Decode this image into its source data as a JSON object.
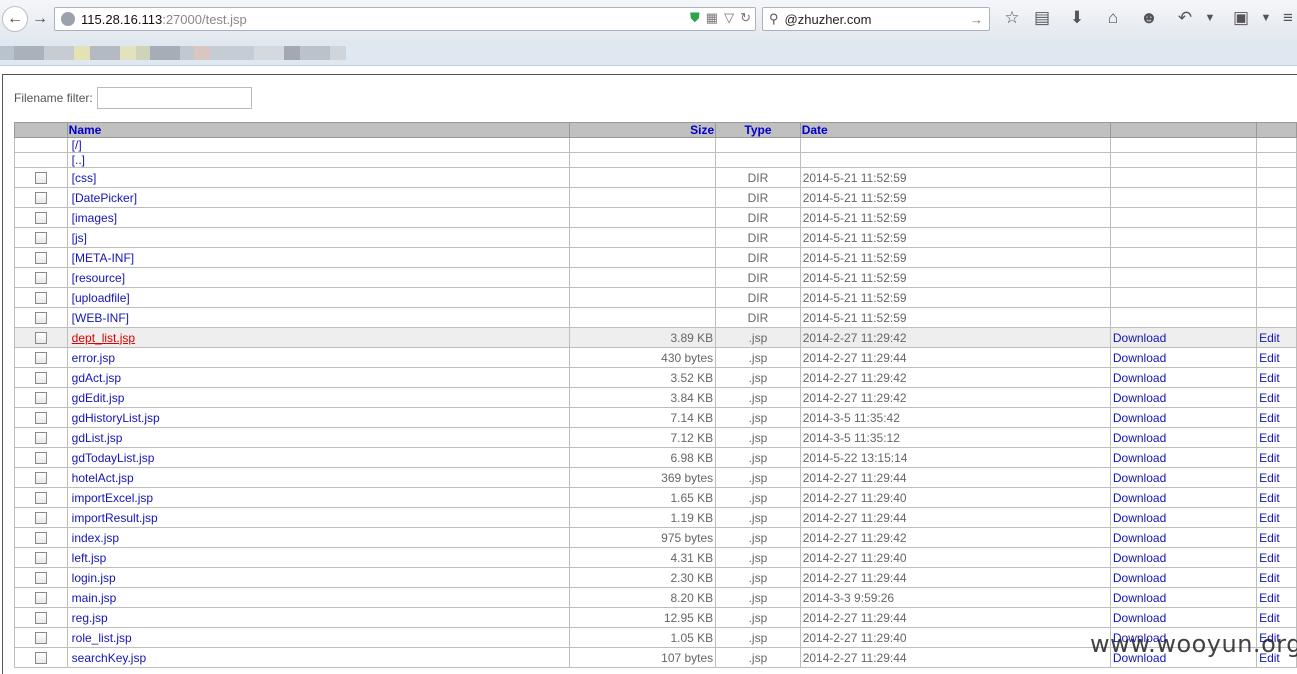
{
  "browser": {
    "url_host": "115.28.16.113",
    "url_rest": ":27000/test.jsp",
    "search_text": "@zhuzher.com"
  },
  "filter": {
    "label": "Filename filter:",
    "value": ""
  },
  "table": {
    "headers": {
      "name": "Name",
      "size": "Size",
      "type": "Type",
      "date": "Date"
    },
    "nav": [
      "[/]",
      "[..]"
    ],
    "rows": [
      {
        "name": "[css]",
        "size": "",
        "type": "DIR",
        "date": "2014-5-21 11:52:59",
        "download": "",
        "edit": ""
      },
      {
        "name": "[DatePicker]",
        "size": "",
        "type": "DIR",
        "date": "2014-5-21 11:52:59",
        "download": "",
        "edit": ""
      },
      {
        "name": "[images]",
        "size": "",
        "type": "DIR",
        "date": "2014-5-21 11:52:59",
        "download": "",
        "edit": ""
      },
      {
        "name": "[js]",
        "size": "",
        "type": "DIR",
        "date": "2014-5-21 11:52:59",
        "download": "",
        "edit": ""
      },
      {
        "name": "[META-INF]",
        "size": "",
        "type": "DIR",
        "date": "2014-5-21 11:52:59",
        "download": "",
        "edit": ""
      },
      {
        "name": "[resource]",
        "size": "",
        "type": "DIR",
        "date": "2014-5-21 11:52:59",
        "download": "",
        "edit": ""
      },
      {
        "name": "[uploadfile]",
        "size": "",
        "type": "DIR",
        "date": "2014-5-21 11:52:59",
        "download": "",
        "edit": ""
      },
      {
        "name": "[WEB-INF]",
        "size": "",
        "type": "DIR",
        "date": "2014-5-21 11:52:59",
        "download": "",
        "edit": ""
      },
      {
        "name": "dept_list.jsp",
        "size": "3.89 KB",
        "type": ".jsp",
        "date": "2014-2-27 11:29:42",
        "download": "Download",
        "edit": "Edit",
        "hover": true
      },
      {
        "name": "error.jsp",
        "size": "430 bytes",
        "type": ".jsp",
        "date": "2014-2-27 11:29:44",
        "download": "Download",
        "edit": "Edit"
      },
      {
        "name": "gdAct.jsp",
        "size": "3.52 KB",
        "type": ".jsp",
        "date": "2014-2-27 11:29:42",
        "download": "Download",
        "edit": "Edit"
      },
      {
        "name": "gdEdit.jsp",
        "size": "3.84 KB",
        "type": ".jsp",
        "date": "2014-2-27 11:29:42",
        "download": "Download",
        "edit": "Edit"
      },
      {
        "name": "gdHistoryList.jsp",
        "size": "7.14 KB",
        "type": ".jsp",
        "date": "2014-3-5 11:35:42",
        "download": "Download",
        "edit": "Edit"
      },
      {
        "name": "gdList.jsp",
        "size": "7.12 KB",
        "type": ".jsp",
        "date": "2014-3-5 11:35:12",
        "download": "Download",
        "edit": "Edit"
      },
      {
        "name": "gdTodayList.jsp",
        "size": "6.98 KB",
        "type": ".jsp",
        "date": "2014-5-22 13:15:14",
        "download": "Download",
        "edit": "Edit"
      },
      {
        "name": "hotelAct.jsp",
        "size": "369 bytes",
        "type": ".jsp",
        "date": "2014-2-27 11:29:44",
        "download": "Download",
        "edit": "Edit"
      },
      {
        "name": "importExcel.jsp",
        "size": "1.65 KB",
        "type": ".jsp",
        "date": "2014-2-27 11:29:40",
        "download": "Download",
        "edit": "Edit"
      },
      {
        "name": "importResult.jsp",
        "size": "1.19 KB",
        "type": ".jsp",
        "date": "2014-2-27 11:29:44",
        "download": "Download",
        "edit": "Edit"
      },
      {
        "name": "index.jsp",
        "size": "975 bytes",
        "type": ".jsp",
        "date": "2014-2-27 11:29:42",
        "download": "Download",
        "edit": "Edit"
      },
      {
        "name": "left.jsp",
        "size": "4.31 KB",
        "type": ".jsp",
        "date": "2014-2-27 11:29:40",
        "download": "Download",
        "edit": "Edit"
      },
      {
        "name": "login.jsp",
        "size": "2.30 KB",
        "type": ".jsp",
        "date": "2014-2-27 11:29:44",
        "download": "Download",
        "edit": "Edit"
      },
      {
        "name": "main.jsp",
        "size": "8.20 KB",
        "type": ".jsp",
        "date": "2014-3-3 9:59:26",
        "download": "Download",
        "edit": "Edit"
      },
      {
        "name": "reg.jsp",
        "size": "12.95 KB",
        "type": ".jsp",
        "date": "2014-2-27 11:29:44",
        "download": "Download",
        "edit": "Edit"
      },
      {
        "name": "role_list.jsp",
        "size": "1.05 KB",
        "type": ".jsp",
        "date": "2014-2-27 11:29:40",
        "download": "Download",
        "edit": "Edit"
      },
      {
        "name": "searchKey.jsp",
        "size": "107 bytes",
        "type": ".jsp",
        "date": "2014-2-27 11:29:44",
        "download": "Download",
        "edit": "Edit"
      }
    ]
  },
  "watermark": "www.wooyun.org"
}
